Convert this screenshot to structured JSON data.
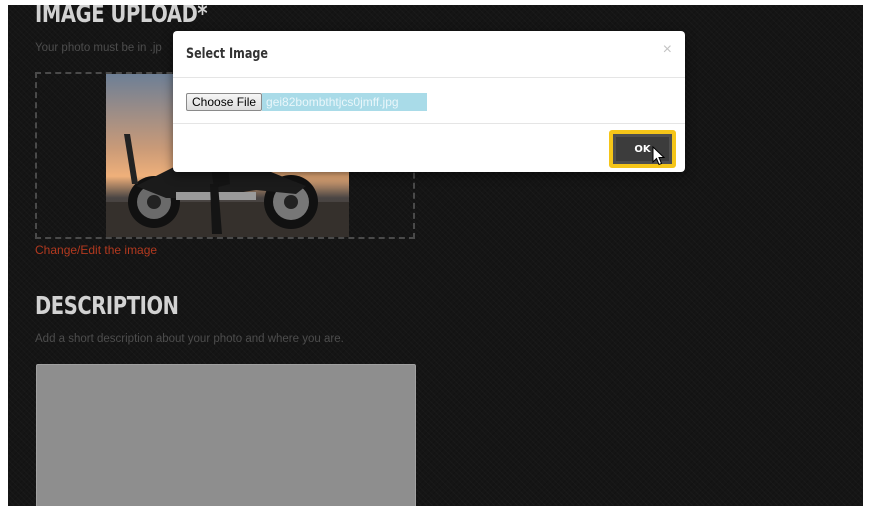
{
  "upload": {
    "heading": "IMAGE UPLOAD*",
    "hint": "Your photo must be in .jp",
    "change_link": "Change/Edit the image"
  },
  "description": {
    "heading": "DESCRIPTION",
    "hint": "Add a short description about your photo and where you are.",
    "value": ""
  },
  "modal": {
    "title": "Select Image",
    "close": "×",
    "choose_file_label": "Choose File",
    "file_name": "gei82bombthtjcs0jmff.jpg",
    "ok_label": "OK"
  },
  "colors": {
    "page_background": "#151515",
    "link_accent": "#b2391f",
    "highlight": "#f5c518",
    "file_selection": "#a9dbe8"
  },
  "icons": {
    "cursor": "mouse-pointer-icon",
    "close": "close-icon"
  }
}
